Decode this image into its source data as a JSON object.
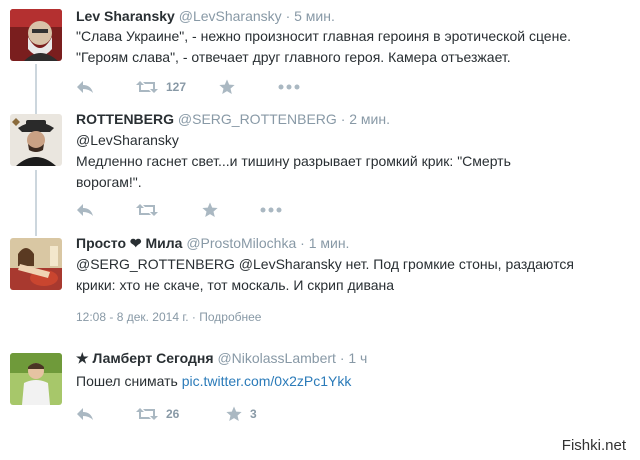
{
  "tweets": [
    {
      "name": "Lev Sharansky",
      "handle": "@LevSharansky",
      "time": "· 5 мин.",
      "lines": [
        "\"Слава Украине\", - нежно произносит главная героиня в эротической сцене.",
        "\"Героям слава\", - отвечает друг главного героя. Камера отъезжает."
      ],
      "retweet_count": "127"
    },
    {
      "name": "ROTTENBERG",
      "handle": "@SERG_ROTTENBERG",
      "time": "· 2 мин.",
      "lines": [
        "@LevSharansky",
        "Медленно гаснет свет...и тишину разрывает громкий крик: \"Смерть",
        "ворогам!\"."
      ]
    },
    {
      "name": "Просто ❤ Мила",
      "handle": "@ProstoMilochka",
      "time": "· 1 мин.",
      "lines": [
        "@SERG_ROTTENBERG @LevSharansky нет. Под громкие стоны, раздаются",
        "крики: хто не скаче, тот москаль. И скрип дивана"
      ],
      "timestamp": "12:08 - 8 дек. 2014 г.",
      "details_link": "· Подробнее"
    },
    {
      "name": "★ Ламберт Сегодня",
      "handle": "@NikolassLambert",
      "time": "· 1 ч",
      "text_prefix": "Пошел снимать ",
      "link": "pic.twitter.com/0x2zPc1Ykk",
      "retweet_count": "26",
      "favorite_count": "3"
    }
  ],
  "watermark": "Fishki.net",
  "icons": {
    "reply": "reply-icon",
    "retweet": "retweet-icon",
    "favorite": "star-icon",
    "more": "more-icon"
  },
  "colors": {
    "text": "#292f33",
    "secondary": "#8899a6",
    "icon": "#aab8c2",
    "link": "#2b7bb9",
    "thread_line": "#ccd6dd"
  }
}
